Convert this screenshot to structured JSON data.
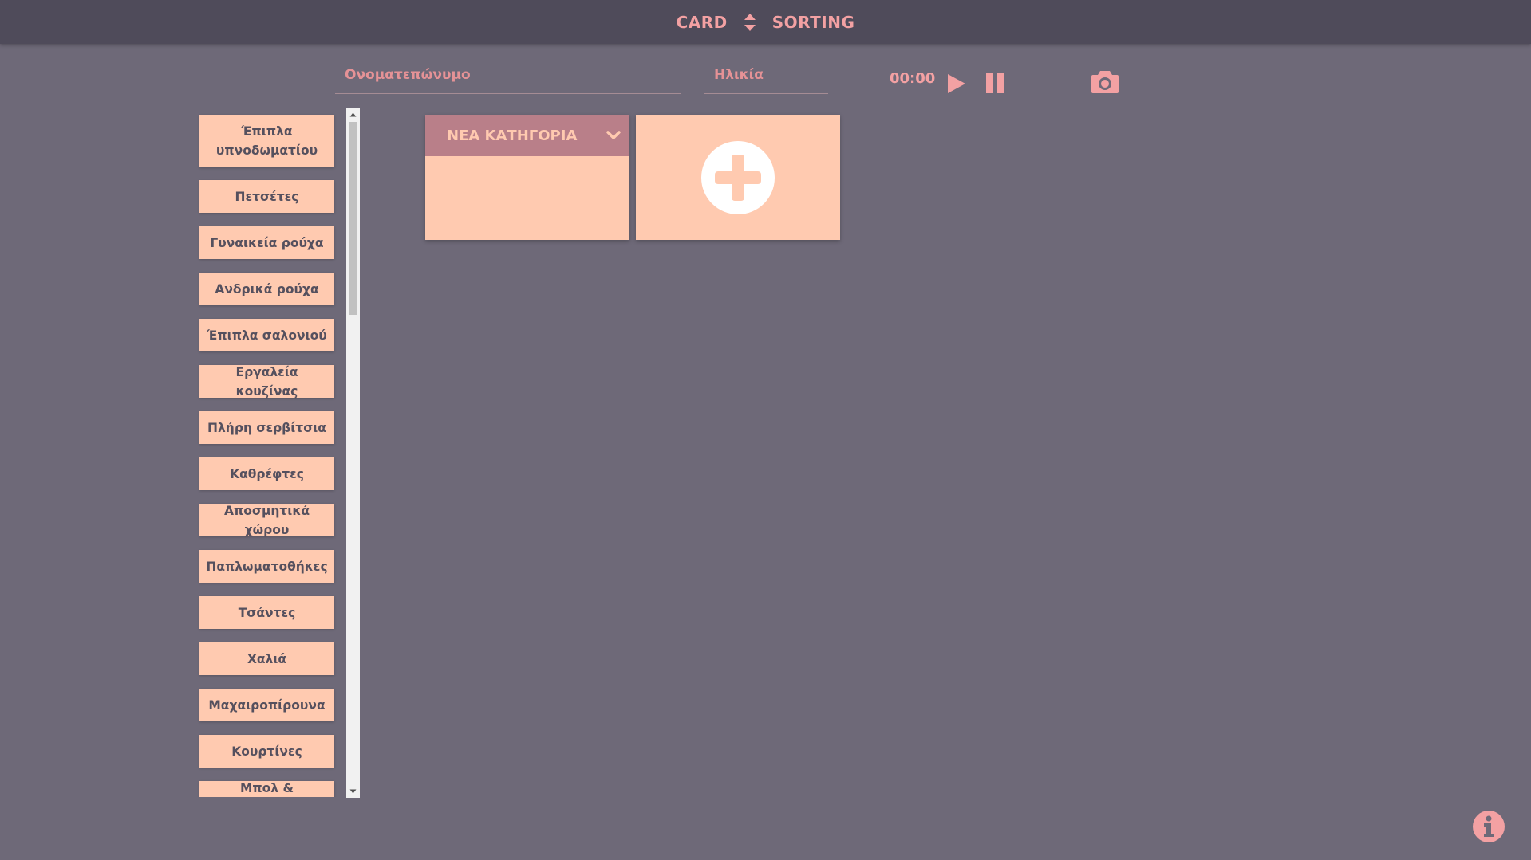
{
  "header": {
    "title_left": "CARD",
    "title_right": "SORTING",
    "sort_icon": "sort-updown-icon"
  },
  "participant": {
    "name_placeholder": "Ονοματεπώνυμο",
    "age_placeholder": "Ηλικία"
  },
  "timer": {
    "value": "00:00",
    "play_icon": "play-icon",
    "pause_icon": "pause-icon",
    "camera_icon": "camera-icon"
  },
  "cards": [
    "Έπιπλα υπνοδωματίου",
    "Πετσέτες",
    "Γυναικεία ρούχα",
    "Ανδρικά ρούχα",
    "Έπιπλα σαλονιού",
    "Εργαλεία κουζίνας",
    "Πλήρη σερβίτσια",
    "Καθρέφτες",
    "Αποσμητικά χώρου",
    "Παπλωματοθήκες",
    "Τσάντες",
    "Χαλιά",
    "Μαχαιροπίρουνα",
    "Κουρτίνες",
    "Μπολ & κελυφάκια"
  ],
  "category": {
    "title": "ΝΕΑ ΚΑΤΗΓΟΡΙΑ",
    "toggle_icon": "chevron-down-icon"
  },
  "add_category_icon": "plus-circle-icon",
  "info_icon": "info-icon",
  "colors": {
    "background": "#6e6978",
    "topbar": "#4f4b5a",
    "accent": "#f3a1a3",
    "card": "#ffcab0",
    "category_header": "#b97f89",
    "card_text": "#55505e"
  }
}
